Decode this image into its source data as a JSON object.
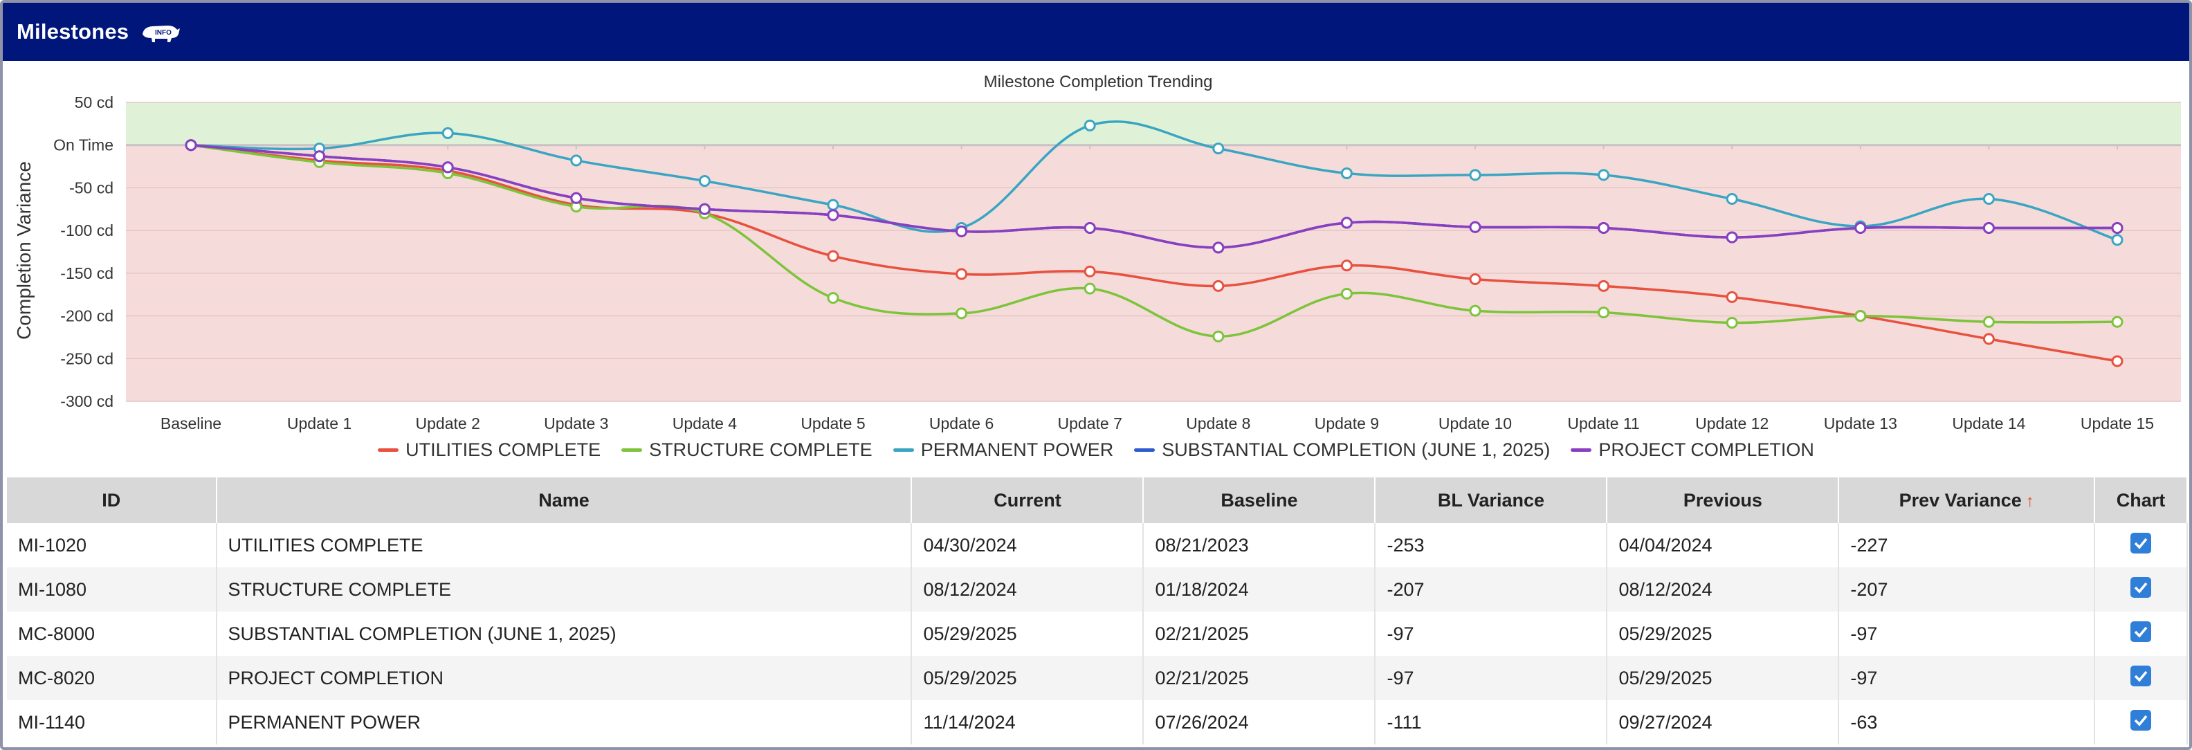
{
  "header": {
    "title": "Milestones",
    "info_icon": "rhino-info-icon"
  },
  "chart_data": {
    "type": "line",
    "title": "Milestone Completion Trending",
    "ylabel": "Completion Variance",
    "xlabel": "",
    "categories": [
      "Baseline",
      "Update 1",
      "Update 2",
      "Update 3",
      "Update 4",
      "Update 5",
      "Update 6",
      "Update 7",
      "Update 8",
      "Update 9",
      "Update 10",
      "Update 11",
      "Update 12",
      "Update 13",
      "Update 14",
      "Update 15"
    ],
    "ylim": [
      -300,
      50
    ],
    "yticks": [
      {
        "value": 50,
        "label": "50 cd"
      },
      {
        "value": 0,
        "label": "On Time"
      },
      {
        "value": -50,
        "label": "-50 cd"
      },
      {
        "value": -100,
        "label": "-100 cd"
      },
      {
        "value": -150,
        "label": "-150 cd"
      },
      {
        "value": -200,
        "label": "-200 cd"
      },
      {
        "value": -250,
        "label": "-250 cd"
      },
      {
        "value": -300,
        "label": "-300 cd"
      }
    ],
    "bands": [
      {
        "from": 0,
        "to": 50,
        "color": "#dff2d8"
      },
      {
        "from": -300,
        "to": 0,
        "color": "#f5dcdb"
      }
    ],
    "grid": true,
    "legend_position": "bottom",
    "series": [
      {
        "name": "UTILITIES COMPLETE",
        "color": "#e8513f",
        "values": [
          0,
          -18,
          -30,
          -70,
          -80,
          -130,
          -151,
          -148,
          -165,
          -141,
          -157,
          -165,
          -178,
          -200,
          -227,
          -253
        ]
      },
      {
        "name": "STRUCTURE COMPLETE",
        "color": "#7dc43a",
        "values": [
          0,
          -20,
          -33,
          -72,
          -80,
          -179,
          -197,
          -168,
          -224,
          -174,
          -194,
          -196,
          -208,
          -200,
          -207,
          -207
        ]
      },
      {
        "name": "PERMANENT POWER",
        "color": "#3aa5c2",
        "values": [
          0,
          -4,
          14,
          -18,
          -42,
          -70,
          -97,
          23,
          -4,
          -33,
          -35,
          -35,
          -63,
          -95,
          -63,
          -111
        ]
      },
      {
        "name": "SUBSTANTIAL COMPLETION (JUNE 1, 2025)",
        "color": "#2c5bd0",
        "values": [
          0,
          -13,
          -26,
          -62,
          -75,
          -82,
          -101,
          -97,
          -120,
          -91,
          -96,
          -97,
          -108,
          -97,
          -97,
          -97
        ]
      },
      {
        "name": "PROJECT COMPLETION",
        "color": "#8a3ec0",
        "values": [
          0,
          -13,
          -26,
          -62,
          -75,
          -82,
          -101,
          -97,
          -120,
          -91,
          -96,
          -97,
          -108,
          -97,
          -97,
          -97
        ]
      }
    ]
  },
  "table": {
    "columns": [
      "ID",
      "Name",
      "Current",
      "Baseline",
      "BL Variance",
      "Previous",
      "Prev Variance",
      "Chart"
    ],
    "sort_indicator": "↑",
    "rows": [
      {
        "id": "MI-1020",
        "name": "UTILITIES COMPLETE",
        "current": "04/30/2024",
        "baseline": "08/21/2023",
        "bl_variance": "-253",
        "previous": "04/04/2024",
        "prev_variance": "-227",
        "chart": true
      },
      {
        "id": "MI-1080",
        "name": "STRUCTURE COMPLETE",
        "current": "08/12/2024",
        "baseline": "01/18/2024",
        "bl_variance": "-207",
        "previous": "08/12/2024",
        "prev_variance": "-207",
        "chart": true
      },
      {
        "id": "MC-8000",
        "name": "SUBSTANTIAL COMPLETION (JUNE 1, 2025)",
        "current": "05/29/2025",
        "baseline": "02/21/2025",
        "bl_variance": "-97",
        "previous": "05/29/2025",
        "prev_variance": "-97",
        "chart": true
      },
      {
        "id": "MC-8020",
        "name": "PROJECT COMPLETION",
        "current": "05/29/2025",
        "baseline": "02/21/2025",
        "bl_variance": "-97",
        "previous": "05/29/2025",
        "prev_variance": "-97",
        "chart": true
      },
      {
        "id": "MI-1140",
        "name": "PERMANENT POWER",
        "current": "11/14/2024",
        "baseline": "07/26/2024",
        "bl_variance": "-111",
        "previous": "09/27/2024",
        "prev_variance": "-63",
        "chart": true
      }
    ]
  }
}
